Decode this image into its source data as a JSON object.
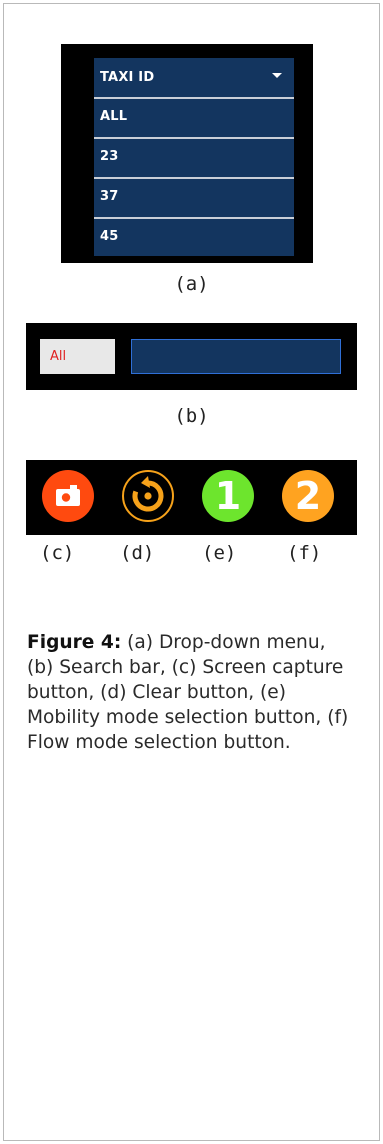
{
  "dropdown": {
    "header": "TAXI ID",
    "options": [
      "ALL",
      "23",
      "37",
      "45"
    ]
  },
  "search": {
    "select_value": "All",
    "input_value": ""
  },
  "buttons": {
    "mode1_label": "1",
    "mode2_label": "2"
  },
  "labels": {
    "a": "(a)",
    "b": "(b)",
    "c": "(c)",
    "d": "(d)",
    "e": "(e)",
    "f": "(f)"
  },
  "figure_caption": {
    "lead": "Figure 4:",
    "body": " (a) Drop-down menu, (b) Search bar, (c) Screen capture button, (d) Clear button, (e) Mobility mode selection button, (f) Flow mode selection button."
  },
  "colors": {
    "panel_bg": "#000000",
    "dropdown_bg": "#13355f",
    "capture_red": "#ff4a0f",
    "clear_orange": "#f6a21a",
    "mode1_green": "#6de52d",
    "mode2_orange": "#ffa320",
    "select_text_red": "#e02020"
  }
}
